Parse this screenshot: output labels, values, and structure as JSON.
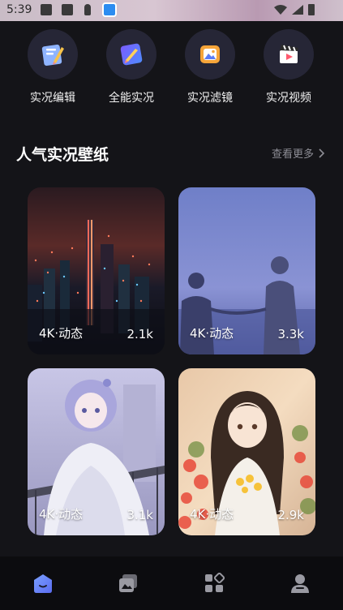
{
  "status_bar": {
    "time": "5:39"
  },
  "quick_actions": [
    {
      "label": "实况编辑",
      "icon": "live-edit-icon"
    },
    {
      "label": "全能实况",
      "icon": "all-live-icon"
    },
    {
      "label": "实况滤镜",
      "icon": "live-filter-icon"
    },
    {
      "label": "实况视频",
      "icon": "live-video-icon"
    }
  ],
  "section": {
    "title": "人气实况壁纸",
    "more": "查看更多"
  },
  "wallpapers": [
    {
      "tag": "4K·动态",
      "count": "2.1k",
      "subject": "city-night"
    },
    {
      "tag": "4K·动态",
      "count": "3.3k",
      "subject": "couple-silhouette"
    },
    {
      "tag": "4K·动态",
      "count": "3.1k",
      "subject": "anime-girl-balcony"
    },
    {
      "tag": "4K·动态",
      "count": "2.9k",
      "subject": "anime-girl-flowers"
    }
  ],
  "bottom_nav": [
    {
      "icon": "home-icon",
      "active": true
    },
    {
      "icon": "gallery-icon",
      "active": false
    },
    {
      "icon": "apps-icon",
      "active": false
    },
    {
      "icon": "profile-icon",
      "active": false
    }
  ],
  "colors": {
    "background": "#141418",
    "accent": "#5b7cf6",
    "circle": "#262636"
  }
}
